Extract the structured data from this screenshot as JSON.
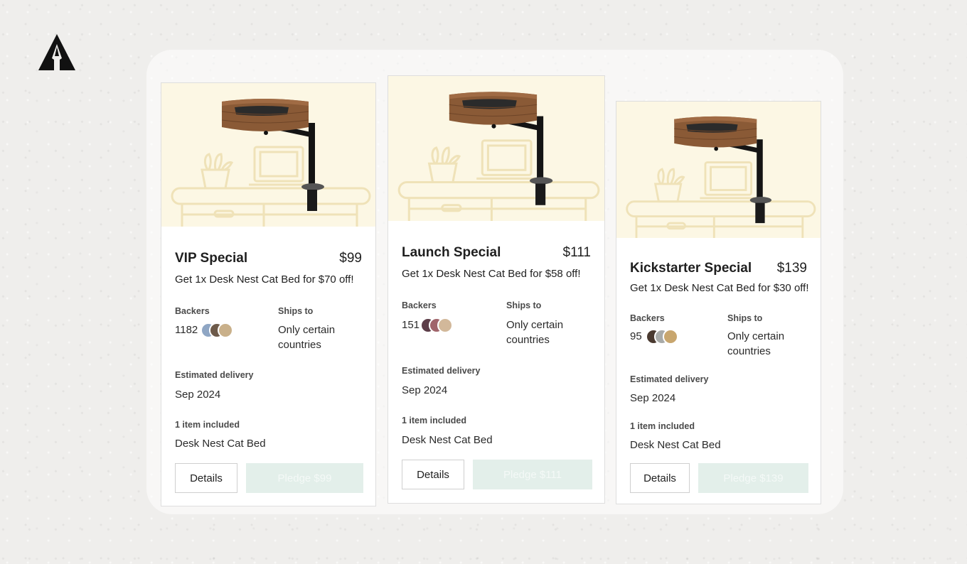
{
  "brand": {
    "logo_icon": "rocket-triangle-icon"
  },
  "labels": {
    "backers": "Backers",
    "ships_to": "Ships to",
    "estimated_delivery": "Estimated delivery",
    "items_included": "1 item included",
    "details_button": "Details"
  },
  "rewards": [
    {
      "title": "VIP Special",
      "price": "$99",
      "description": "Get 1x Desk Nest Cat Bed for $70 off!",
      "backers": "1182",
      "ships_to": "Only certain countries",
      "delivery": "Sep 2024",
      "item": "Desk Nest Cat Bed",
      "pledge_label": "Pledge $99",
      "avatar_colors": [
        "#8fa6c4",
        "#6d5a4a",
        "#c9b08a"
      ]
    },
    {
      "title": "Launch Special",
      "price": "$111",
      "description": "Get 1x Desk Nest Cat Bed for $58 off!",
      "backers": "151",
      "ships_to": "Only certain countries",
      "delivery": "Sep 2024",
      "item": "Desk Nest Cat Bed",
      "pledge_label": "Pledge $111",
      "avatar_colors": [
        "#5c3d48",
        "#a0646a",
        "#d2b89a"
      ]
    },
    {
      "title": "Kickstarter Special",
      "price": "$139",
      "description": "Get 1x Desk Nest Cat Bed for $30 off!",
      "backers": "95",
      "ships_to": "Only certain countries",
      "delivery": "Sep 2024",
      "item": "Desk Nest Cat Bed",
      "pledge_label": "Pledge $139",
      "avatar_colors": [
        "#4a3a30",
        "#a8aaa8",
        "#c8a66e"
      ]
    }
  ],
  "colors": {
    "image_bg": "#fcf7e4",
    "pledge_bg": "#e3efea",
    "wood": "#8a5a36"
  }
}
